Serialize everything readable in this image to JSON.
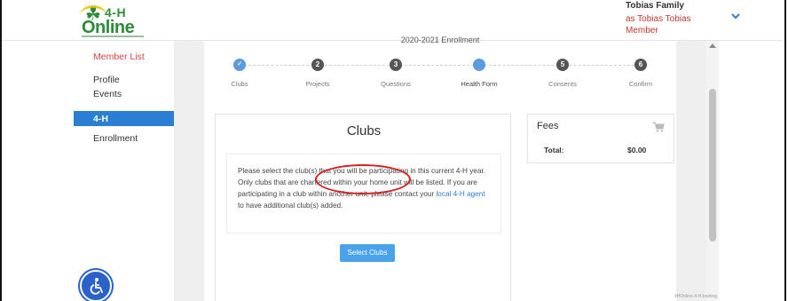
{
  "header": {
    "logo_top": "4-H",
    "logo_bottom": "Online",
    "account_family": "Tobias Family",
    "account_as": "as Tobias Tobias",
    "account_role": "Member"
  },
  "sidebar": {
    "items": [
      {
        "label": "Member List"
      },
      {
        "label": "Profile"
      },
      {
        "label": "Events"
      },
      {
        "label": "4-H"
      },
      {
        "label": "Enrollment"
      }
    ]
  },
  "enrollment": {
    "year_label": "2020-2021 Enrollment",
    "steps": [
      {
        "number": "✓",
        "label": "Clubs",
        "state": "active"
      },
      {
        "number": "2",
        "label": "Projects",
        "state": "todo"
      },
      {
        "number": "3",
        "label": "Questions",
        "state": "todo"
      },
      {
        "number": "",
        "label": "Health Form",
        "state": "done"
      },
      {
        "number": "5",
        "label": "Consents",
        "state": "todo"
      },
      {
        "number": "6",
        "label": "Confirm",
        "state": "todo"
      }
    ]
  },
  "clubs": {
    "title": "Clubs",
    "text_main": "Please select the club(s) that you will be participating in this current 4-H year. Only clubs that are chartered within your home unit will be listed. If you are participating in a club within another unit, please contact your ",
    "link_text": "local 4-H agent",
    "text_after": " to have additional club(s) added.",
    "button_label": "Select Clubs"
  },
  "fees": {
    "title": "Fees",
    "total_label": "Total:",
    "total_value": "$0.00"
  },
  "colors": {
    "accent": "#2a7fd4",
    "brand_green": "#2e8b3a",
    "highlight_red": "#d32020"
  },
  "footer": {
    "watermark": "4HOnline.4-H.training"
  }
}
